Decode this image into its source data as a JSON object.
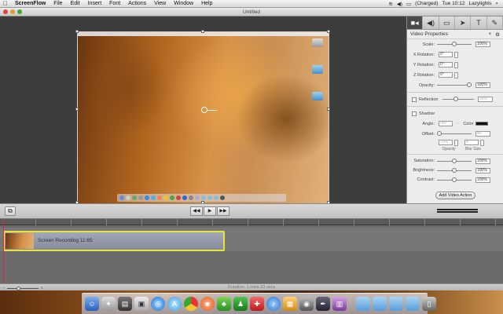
{
  "menubar": {
    "apple_glyph": "",
    "app": "ScreenFlow",
    "items": [
      "File",
      "Edit",
      "Insert",
      "Font",
      "Actions",
      "View",
      "Window",
      "Help"
    ],
    "clock": "Tue 10:12",
    "user": "Lazylights",
    "battery": "(Charged)"
  },
  "window": {
    "title": "Untitled"
  },
  "panel": {
    "heading": "Video Properties",
    "tabs": [
      "video-camera-icon",
      "speaker-icon",
      "screen-icon",
      "pointer-icon",
      "text-icon",
      "annotation-icon"
    ],
    "scale_label": "Scale:",
    "scale_value": "100%",
    "scale_level": 0.5,
    "xrot_label": "X Rotation:",
    "xrot_value": "0°",
    "yrot_label": "Y Rotation:",
    "yrot_value": "0°",
    "zrot_label": "Z Rotation:",
    "zrot_value": "0°",
    "opacity_label": "Opacity:",
    "opacity_value": "100%",
    "opacity_level": 1.0,
    "reflection_label": "Reflection",
    "reflection_value": "30%",
    "shadow_label": "Shadow",
    "angle_label": "Angle:",
    "angle_value": "-45°",
    "color_label": "Color",
    "offset_label": "Offset:",
    "offset_value": "40",
    "shadow_opacity_value": "70%",
    "blur_value": "4",
    "shadow_opacity_label": "Opacity",
    "blur_label": "Blur Size",
    "saturation_label": "Saturation:",
    "saturation_value": "100%",
    "brightness_label": "Brightness:",
    "brightness_value": "100%",
    "contrast_label": "Contrast:",
    "contrast_value": "100%",
    "add_action_label": "Add Video Action"
  },
  "transport": {
    "crop_glyph": "⧉",
    "rewind_glyph": "◀◀",
    "play_glyph": "▶",
    "forward_glyph": "▶▶"
  },
  "timeline": {
    "clip_label": "Screen Recording 11:65"
  },
  "status": {
    "info": "Duration: 1 mins 23 secs"
  },
  "colors": {
    "accent": "#e6e63a",
    "playhead": "#dd2244"
  }
}
